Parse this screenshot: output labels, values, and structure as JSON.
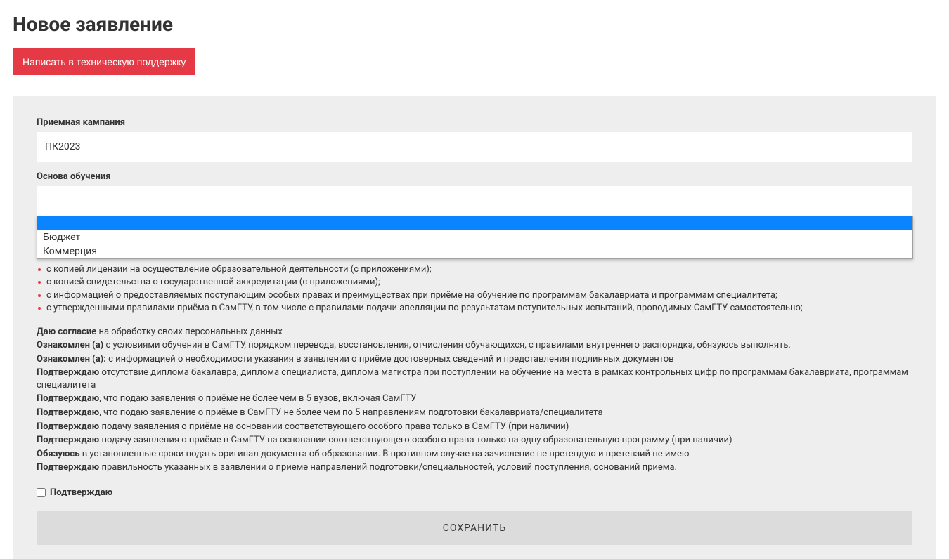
{
  "header": {
    "title": "Новое заявление",
    "support_button": "Написать в техническую поддержку"
  },
  "form": {
    "campaign_label": "Приемная кампания",
    "campaign_value": "ПК2023",
    "basis_label": "Основа обучения",
    "basis_value": "",
    "basis_options": [
      "Бюджет",
      "Коммерция"
    ]
  },
  "info": {
    "familiar_heading": "Ознакомлен (а):",
    "bullets": [
      "с копией лицензии на осуществление образовательной деятельности (с приложениями);",
      "с копией свидетельства о государственной аккредитации (с приложениями);",
      "с информацией о предоставляемых поступающим особых правах и преимуществах при приёме на обучение по программам бакалавриата и программам специалитета;",
      "с утвержденными правилами приёма в СамГТУ, в том числе с правилами подачи апелляции по результатам вступительных испытаний, проводимых СамГТУ самостоятельно;"
    ],
    "consents": [
      {
        "bold": "Даю согласие",
        "text": " на обработку своих персональных данных"
      },
      {
        "bold": "Ознакомлен (а)",
        "text": " с условиями обучения в СамГТУ, порядком перевода, восстановления, отчисления обучающихся, с правилами внутреннего распорядка, обязуюсь выполнять."
      },
      {
        "bold": "Ознакомлен (а):",
        "text": " с информацией о необходимости указания в заявлении о приёме достоверных сведений и представления подлинных документов"
      },
      {
        "bold": "Подтверждаю",
        "text": " отсутствие диплома бакалавра, диплома специалиста, диплома магистра при поступлении на обучение на места в рамках контрольных цифр по программам бакалавриата, программам специалитета"
      },
      {
        "bold": "Подтверждаю",
        "text": ", что подаю заявления о приёме не более чем в 5 вузов, включая СамГТУ"
      },
      {
        "bold": "Подтверждаю",
        "text": ", что подаю заявление о приёме в СамГТУ не более чем по 5 направлениям подготовки бакалавриата/специалитета"
      },
      {
        "bold": "Подтверждаю",
        "text": " подачу заявления о приёме на основании соответствующего особого права только в СамГТУ (при наличии)"
      },
      {
        "bold": "Подтверждаю",
        "text": " подачу заявления о приёме в СамГТУ на основании соответствующего особого права только на одну образовательную программу (при наличии)"
      },
      {
        "bold": "Обязуюсь",
        "text": " в установленные сроки подать оригинал документа об образовании. В противном случае на зачисление не претендую и претензий не имею"
      },
      {
        "bold": "Подтверждаю",
        "text": " правильность указанных в заявлении о приеме направлений подготовки/специальностей, условий поступления, оснований приема."
      }
    ],
    "confirm_label": "Подтверждаю",
    "save_button": "СОХРАНИТЬ"
  }
}
